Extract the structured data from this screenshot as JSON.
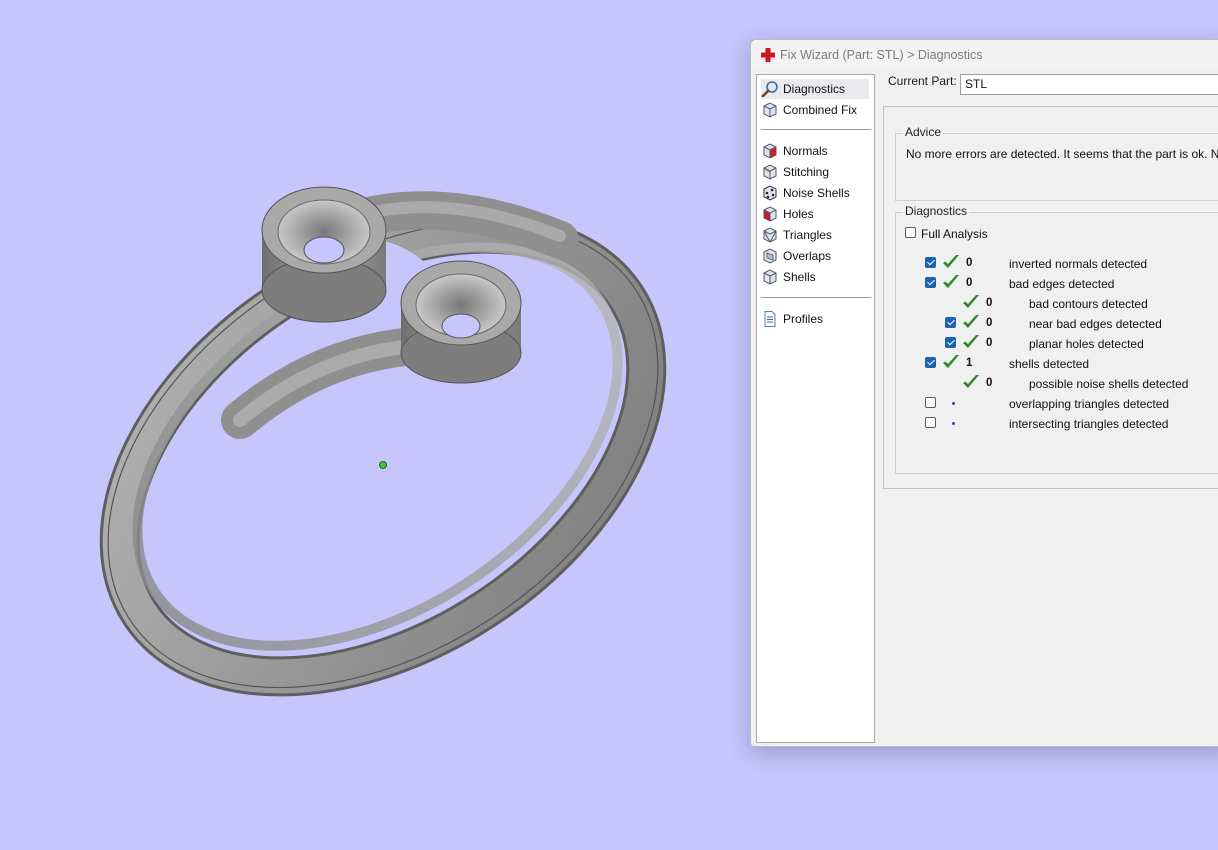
{
  "window": {
    "title": "Fix Wizard (Part: STL) > Diagnostics"
  },
  "nav": {
    "items": [
      {
        "label": "Diagnostics",
        "icon": "magnifier-icon",
        "selected": true
      },
      {
        "label": "Combined Fix",
        "icon": "cube-stack-icon",
        "selected": false
      },
      {
        "label": "Normals",
        "icon": "normals-cube-icon",
        "selected": false
      },
      {
        "label": "Stitching",
        "icon": "stitching-cube-icon",
        "selected": false
      },
      {
        "label": "Noise Shells",
        "icon": "noise-shells-icon",
        "selected": false
      },
      {
        "label": "Holes",
        "icon": "holes-cube-icon",
        "selected": false
      },
      {
        "label": "Triangles",
        "icon": "triangles-cube-icon",
        "selected": false
      },
      {
        "label": "Overlaps",
        "icon": "overlaps-cube-icon",
        "selected": false
      },
      {
        "label": "Shells",
        "icon": "shells-cube-icon",
        "selected": false
      },
      {
        "label": "Profiles",
        "icon": "document-icon",
        "selected": false
      }
    ]
  },
  "current_part": {
    "label": "Current Part:",
    "value": "STL"
  },
  "advice": {
    "title": "Advice",
    "text": "No more errors are detected. It seems that the part is ok. Note th"
  },
  "diagnostics": {
    "title": "Diagnostics",
    "full_analysis_label": "Full Analysis",
    "full_analysis_checked": false,
    "rows": [
      {
        "checkbox": true,
        "checked": true,
        "status": "ok",
        "count": "0",
        "label": "inverted normals detected",
        "indent": 0
      },
      {
        "checkbox": true,
        "checked": true,
        "status": "ok",
        "count": "0",
        "label": "bad edges detected",
        "indent": 0
      },
      {
        "checkbox": false,
        "checked": false,
        "status": "ok",
        "count": "0",
        "label": "bad contours detected",
        "indent": 1
      },
      {
        "checkbox": true,
        "checked": true,
        "status": "ok",
        "count": "0",
        "label": "near bad edges detected",
        "indent": 1
      },
      {
        "checkbox": true,
        "checked": true,
        "status": "ok",
        "count": "0",
        "label": "planar holes detected",
        "indent": 1
      },
      {
        "checkbox": true,
        "checked": true,
        "status": "ok",
        "count": "1",
        "label": "shells detected",
        "indent": 0
      },
      {
        "checkbox": false,
        "checked": false,
        "status": "ok",
        "count": "0",
        "label": "possible noise shells detected",
        "indent": 1
      },
      {
        "checkbox": true,
        "checked": false,
        "status": "pending",
        "count": "",
        "label": "overlapping triangles detected",
        "indent": 0
      },
      {
        "checkbox": true,
        "checked": false,
        "status": "pending",
        "count": "",
        "label": "intersecting triangles detected",
        "indent": 0
      }
    ]
  },
  "colors": {
    "viewport_background": "#c6c6fc",
    "model_gray": "#8e8e8e",
    "check_green": "#2e8b2e",
    "checkbox_blue": "#1a62b3",
    "pivot_marker": "#33cc33"
  }
}
